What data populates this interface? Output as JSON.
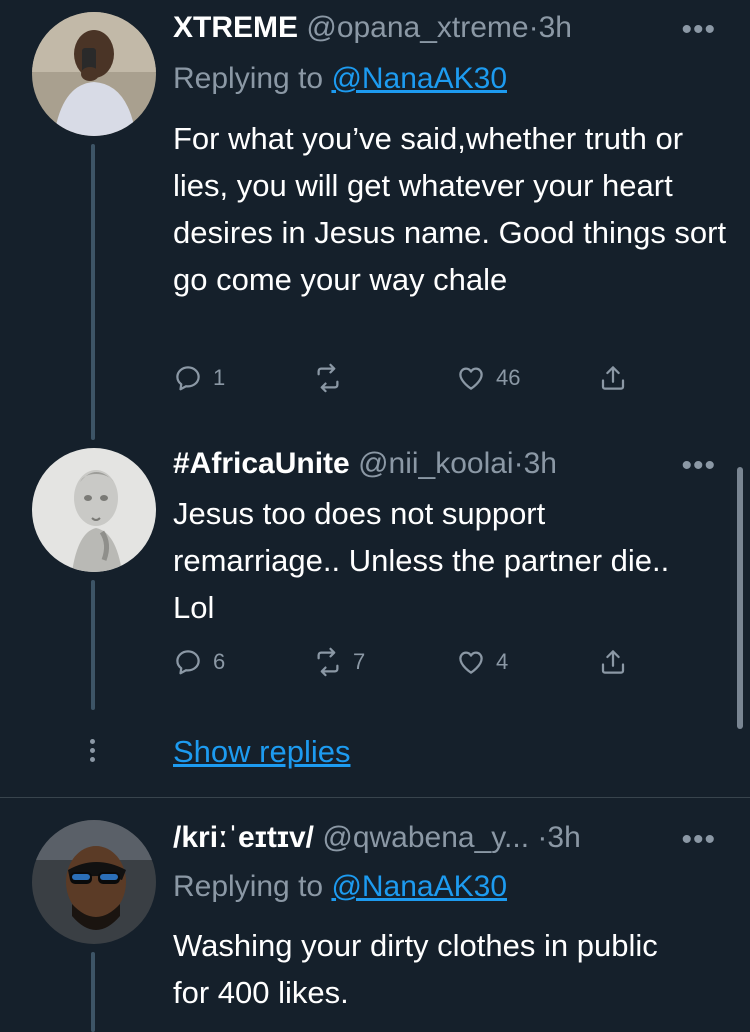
{
  "tweets": [
    {
      "name": "XTREME",
      "handle": "@opana_xtreme",
      "dot": "·",
      "time": "3h",
      "replying_label": "Replying to ",
      "replying_handle": "@NanaAK30",
      "text": "For what you’ve said,whether truth or lies, you will get whatever your heart desires in Jesus name. Good things sort go come your way chale",
      "replies": "1",
      "retweets": "",
      "likes": "46"
    },
    {
      "name": "#AfricaUnite",
      "handle": "@nii_koolai",
      "dot": "·",
      "time": "3h",
      "text": "Jesus too does not support remarriage.. Unless the partner die.. Lol",
      "replies": "6",
      "retweets": "7",
      "likes": "4"
    },
    {
      "name": "/kriːˈeɪtɪv/",
      "handle": "@qwabena_y...",
      "dot": "·",
      "time": "3h",
      "replying_label": "Replying to ",
      "replying_handle": "@NanaAK30",
      "text": "Washing your dirty clothes in public for 400 likes."
    }
  ],
  "show_replies": "Show replies",
  "more_glyph": "•••",
  "colors": {
    "background": "#15202b",
    "link": "#1d9bf0",
    "secondary": "#8b98a5",
    "thread_line": "#3d5466"
  }
}
